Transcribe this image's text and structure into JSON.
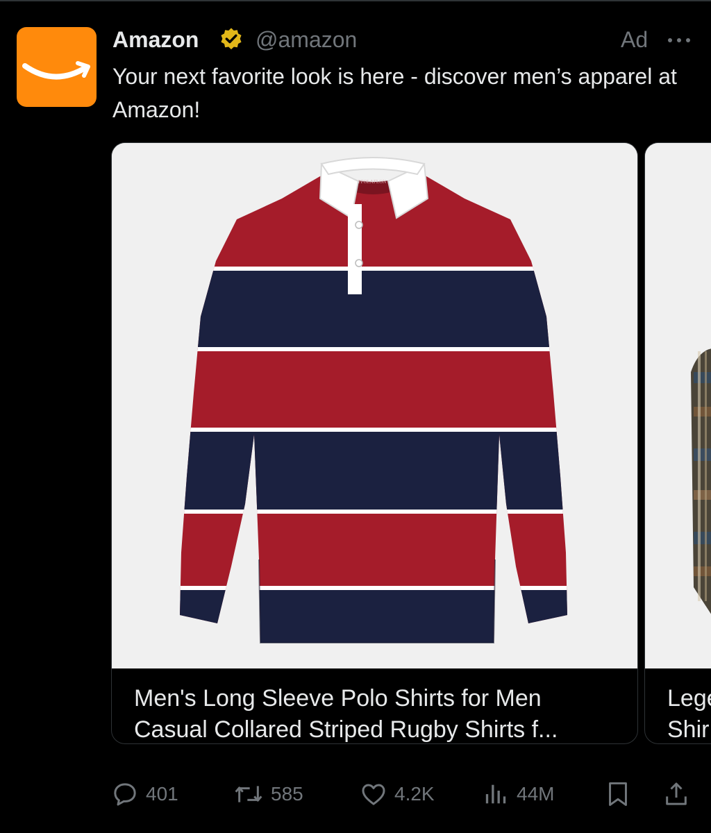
{
  "post": {
    "author_name": "Amazon",
    "handle": "@amazon",
    "ad_label": "Ad",
    "text": "Your next favorite look is here - discover men’s apparel at Amazon!"
  },
  "cards": [
    {
      "title_line1": "Men's Long Sleeve Polo Shirts for Men",
      "title_line2": "Casual Collared Striped Rugby Shirts f...",
      "tag_text": "PPOLAFLON"
    },
    {
      "title_line1": "Lege",
      "title_line2": "Shir"
    }
  ],
  "actions": {
    "replies": "401",
    "reposts": "585",
    "likes": "4.2K",
    "views": "44M"
  },
  "colors": {
    "background": "#000000",
    "brand_orange": "#ff8a0c",
    "verified_gold": "#e2b719",
    "muted_text": "#71767b",
    "shirt_red": "#a51c2a",
    "shirt_navy": "#1b2140"
  },
  "icons": [
    "amazon-smile-logo",
    "verified-badge-icon",
    "more-options-icon",
    "reply-icon",
    "repost-icon",
    "like-icon",
    "views-icon",
    "bookmark-icon",
    "share-icon"
  ]
}
